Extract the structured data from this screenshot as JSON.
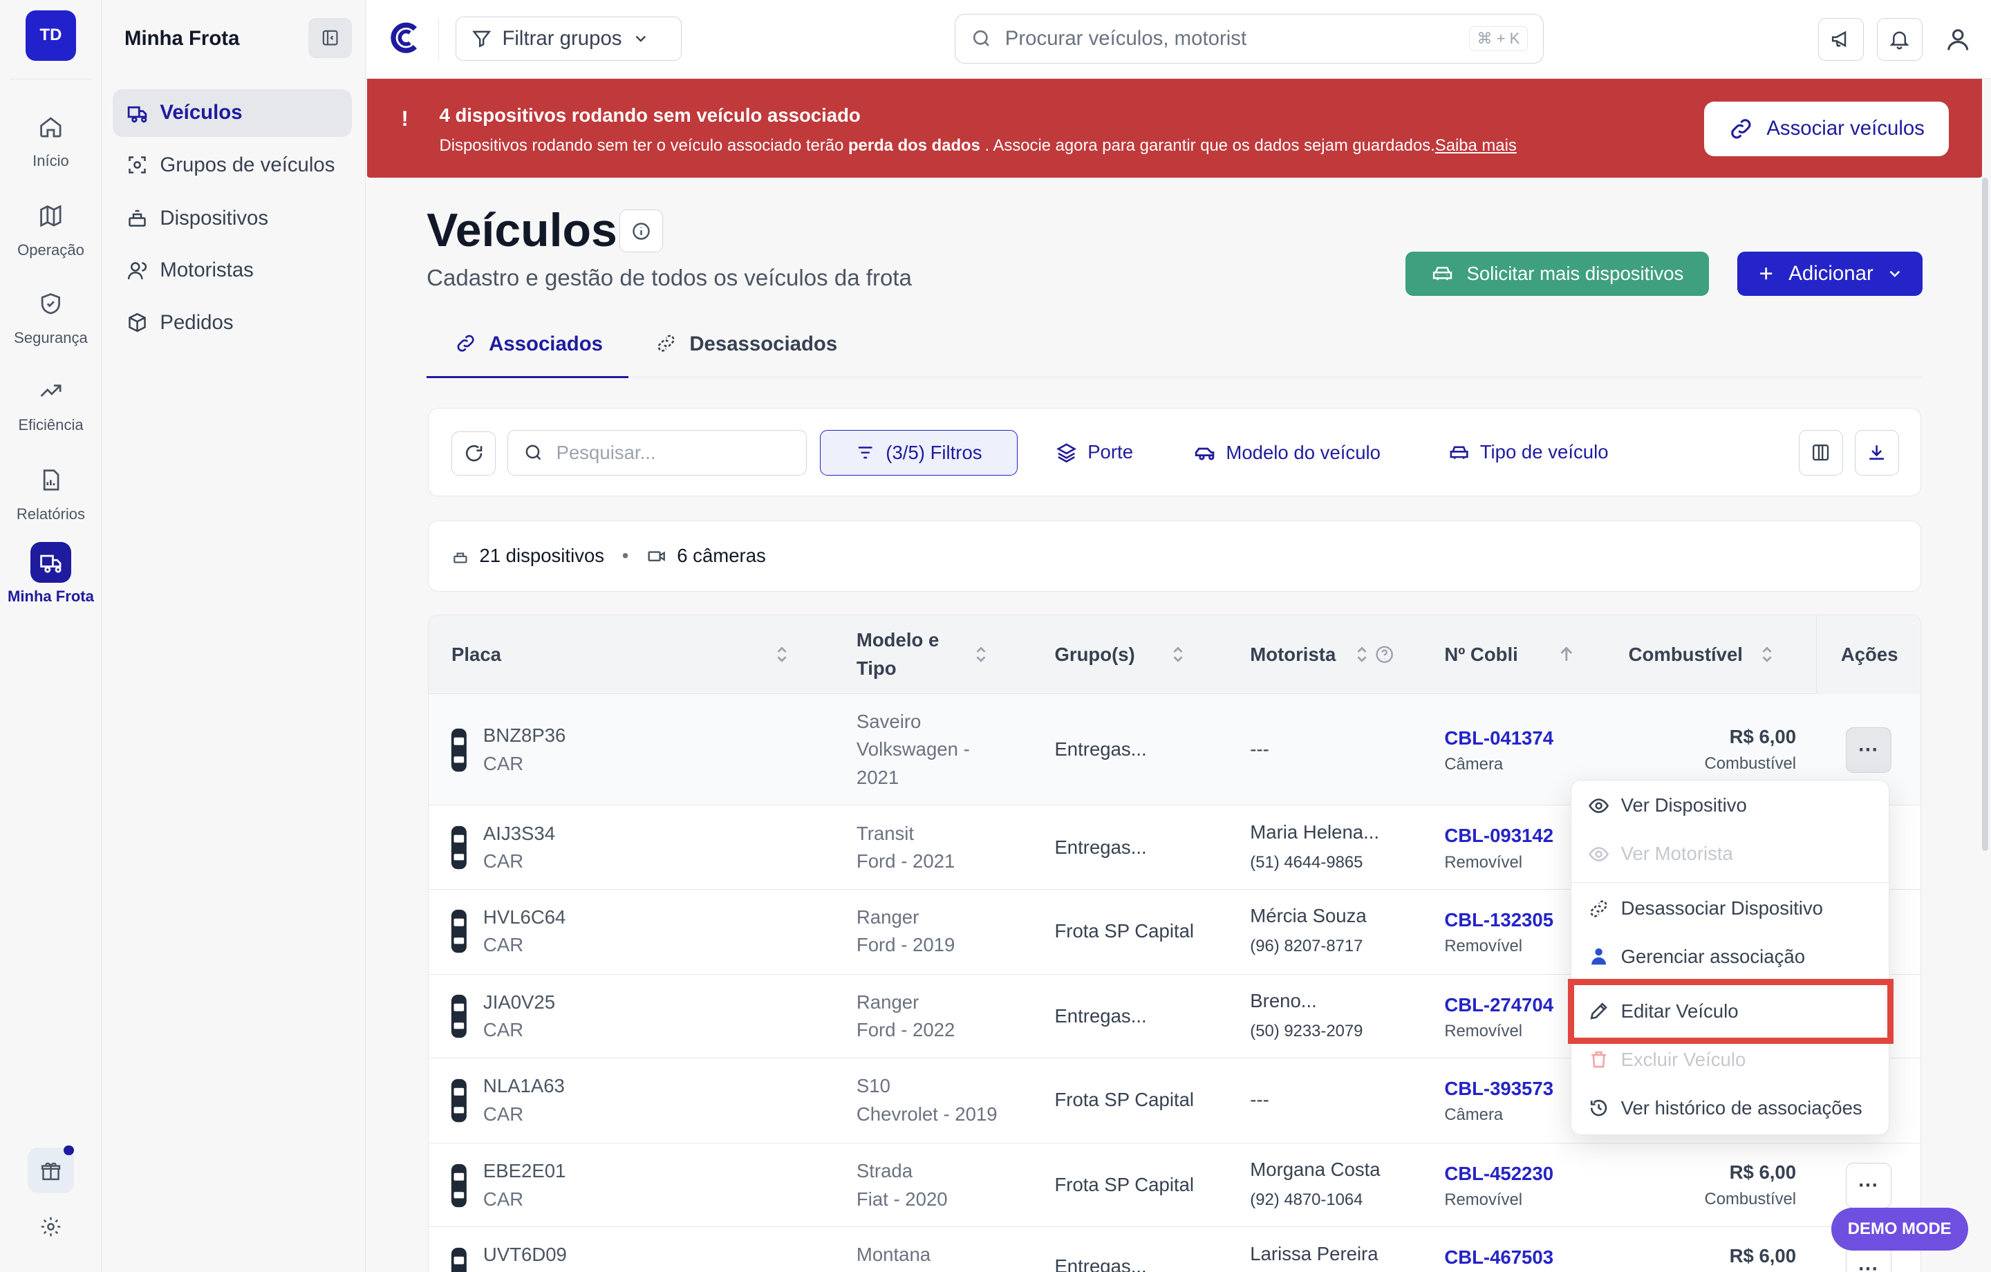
{
  "rail": {
    "avatar": "TD",
    "items": [
      {
        "label": "Início",
        "icon": "home-icon"
      },
      {
        "label": "Operação",
        "icon": "map-icon"
      },
      {
        "label": "Segurança",
        "icon": "shield-icon"
      },
      {
        "label": "Eficiência",
        "icon": "trending-icon"
      },
      {
        "label": "Relatórios",
        "icon": "report-icon"
      },
      {
        "label": "Minha Frota",
        "icon": "truck-icon",
        "active": true
      }
    ]
  },
  "sidenav": {
    "title": "Minha Frota",
    "items": [
      {
        "label": "Veículos",
        "active": true
      },
      {
        "label": "Grupos de veículos"
      },
      {
        "label": "Dispositivos"
      },
      {
        "label": "Motoristas"
      },
      {
        "label": "Pedidos"
      }
    ]
  },
  "topbar": {
    "filter_groups": "Filtrar grupos",
    "search_placeholder": "Procurar veículos, motorist",
    "shortcut": "⌘ + K"
  },
  "alert": {
    "excl": "!",
    "title": "4 dispositivos rodando sem veículo associado",
    "desc_pre": "Dispositivos rodando sem ter o veículo associado terão ",
    "desc_bold": "perda dos dados",
    "desc_post": " . Associe agora para garantir que os dados sejam guardados.",
    "desc_link": "Saiba mais",
    "button": "Associar veículos"
  },
  "page": {
    "title": "Veículos",
    "subtitle": "Cadastro e gestão de todos os veículos da frota",
    "btn_request": "Solicitar mais dispositivos",
    "btn_add": "Adicionar"
  },
  "tabs": [
    {
      "label": "Associados",
      "active": true
    },
    {
      "label": "Desassociados"
    }
  ],
  "filterbar": {
    "search_placeholder": "Pesquisar...",
    "filters": "(3/5) Filtros",
    "chips": [
      "Porte",
      "Modelo do veículo",
      "Tipo de veículo"
    ]
  },
  "summary": {
    "devices": "21 dispositivos",
    "bullet": "•",
    "cameras": "6 câmeras"
  },
  "table": {
    "headers": {
      "plate": "Placa",
      "model": "Modelo e Tipo",
      "groups": "Grupo(s)",
      "driver": "Motorista",
      "cobli": "Nº Cobli",
      "fuel": "Combustível",
      "actions": "Ações"
    },
    "rows": [
      {
        "plate": "BNZ8P36",
        "kind": "CAR",
        "model": "Saveiro",
        "type": "Volkswagen - 2021",
        "group": "Entregas...",
        "driver": "---",
        "phone": "",
        "cobli": "CBL-041374",
        "cobli_type": "Câmera",
        "fuel": "R$ 6,00",
        "fuel_label": "Combustível"
      },
      {
        "plate": "AIJ3S34",
        "kind": "CAR",
        "model": "Transit",
        "type": "Ford - 2021",
        "group": "Entregas...",
        "driver": "Maria Helena...",
        "phone": "(51) 4644-9865",
        "cobli": "CBL-093142",
        "cobli_type": "Removível",
        "fuel": "",
        "fuel_label": ""
      },
      {
        "plate": "HVL6C64",
        "kind": "CAR",
        "model": "Ranger",
        "type": "Ford - 2019",
        "group": "Frota SP Capital",
        "driver": "Mércia Souza",
        "phone": "(96) 8207-8717",
        "cobli": "CBL-132305",
        "cobli_type": "Removível",
        "fuel": "",
        "fuel_label": ""
      },
      {
        "plate": "JIA0V25",
        "kind": "CAR",
        "model": "Ranger",
        "type": "Ford - 2022",
        "group": "Entregas...",
        "driver": "Breno...",
        "phone": "(50) 9233-2079",
        "cobli": "CBL-274704",
        "cobli_type": "Removível",
        "fuel": "",
        "fuel_label": ""
      },
      {
        "plate": "NLA1A63",
        "kind": "CAR",
        "model": "S10",
        "type": "Chevrolet - 2019",
        "group": "Frota SP Capital",
        "driver": "---",
        "phone": "",
        "cobli": "CBL-393573",
        "cobli_type": "Câmera",
        "fuel": "",
        "fuel_label": ""
      },
      {
        "plate": "EBE2E01",
        "kind": "CAR",
        "model": "Strada",
        "type": "Fiat - 2020",
        "group": "Frota SP Capital",
        "driver": "Morgana Costa",
        "phone": "(92) 4870-1064",
        "cobli": "CBL-452230",
        "cobli_type": "Removível",
        "fuel": "R$ 6,00",
        "fuel_label": "Combustível"
      },
      {
        "plate": "UVT6D09",
        "kind": "",
        "model": "Montana",
        "type": "",
        "group": "Entregas...",
        "driver": "Larissa Pereira",
        "phone": "",
        "cobli": "CBL-467503",
        "cobli_type": "",
        "fuel": "R$ 6,00",
        "fuel_label": ""
      }
    ],
    "more_label": "···"
  },
  "menu": {
    "items": [
      {
        "label": "Ver Dispositivo",
        "icon": "eye-icon"
      },
      {
        "label": "Ver Motorista",
        "icon": "eye-icon",
        "disabled": true
      },
      {
        "label": "Desassociar Dispositivo",
        "icon": "unlink-icon"
      },
      {
        "label": "Gerenciar associação",
        "icon": "user-icon"
      },
      {
        "label": "Editar Veículo",
        "icon": "pencil-icon"
      },
      {
        "label": "Excluir Veículo",
        "icon": "trash-icon",
        "disabled": true
      },
      {
        "label": "Ver histórico de associações",
        "icon": "history-icon"
      }
    ]
  },
  "demo_mode": "DEMO MODE",
  "colors": {
    "brand": "#1e1b9e",
    "alert": "#c0393b",
    "green": "#3ea07e",
    "highlight": "#e0453e"
  }
}
